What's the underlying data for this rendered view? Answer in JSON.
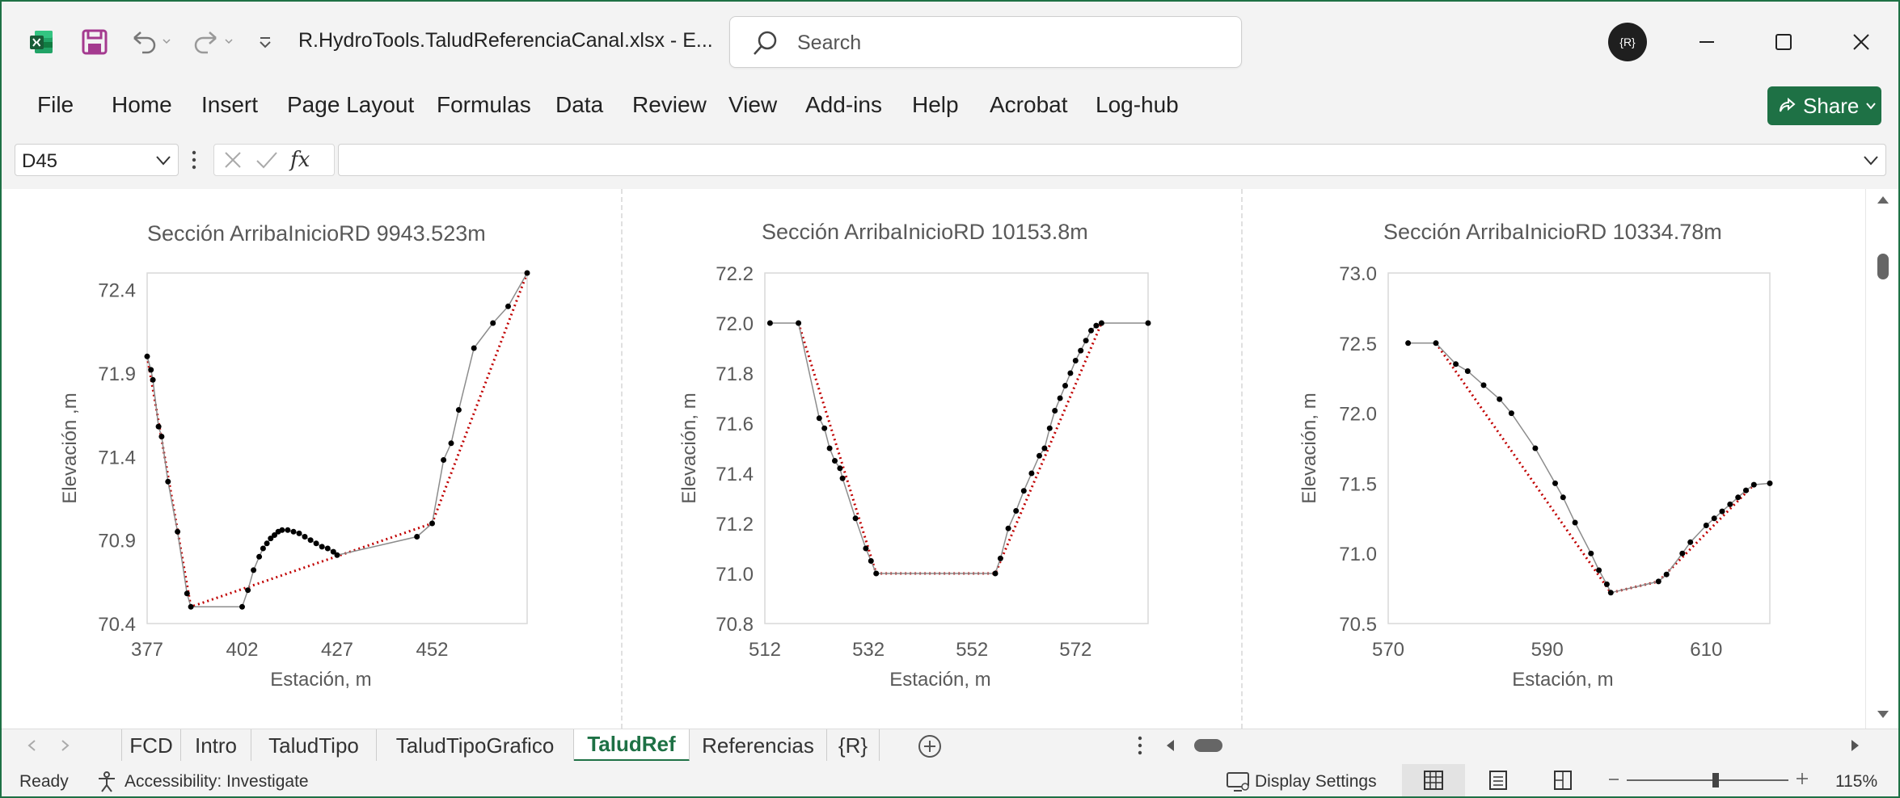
{
  "app": {
    "file_title": "R.HydroTools.TaludReferenciaCanal.xlsx  -  E...",
    "search_placeholder": "Search",
    "avatar_initials": "{R}",
    "share_label": "Share"
  },
  "ribbon": {
    "tabs": [
      "File",
      "Home",
      "Insert",
      "Page Layout",
      "Formulas",
      "Data",
      "Review",
      "View",
      "Add-ins",
      "Help",
      "Acrobat",
      "Log-hub"
    ]
  },
  "formula_bar": {
    "name_box": "D45",
    "fx_label": "fx",
    "formula": ""
  },
  "sheet_tabs": {
    "tabs": [
      "FCD",
      "Intro",
      "TaludTipo",
      "TaludTipoGrafico",
      "TaludRef",
      "Referencias",
      "{R}"
    ],
    "active": "TaludRef"
  },
  "status": {
    "ready": "Ready",
    "accessibility": "Accessibility: Investigate",
    "display_settings": "Display Settings",
    "zoom": "115%",
    "zoom_level_fraction": 0.55
  },
  "colors": {
    "brand_green": "#1e7145",
    "series_terrain": "#000000",
    "series_reference": "#c00000"
  },
  "chart_data": [
    {
      "type": "line",
      "title": "Sección ArribaInicioRD 9943.523m",
      "xlabel": "Estación, m",
      "ylabel": "Elevación ,m",
      "xlim": [
        377,
        477
      ],
      "ylim": [
        70.4,
        72.5
      ],
      "xticks": [
        "377",
        "402",
        "427",
        "452"
      ],
      "yticks": [
        "70.4",
        "70.9",
        "71.4",
        "71.9",
        "72.4"
      ],
      "xtick_values": [
        377,
        402,
        427,
        452
      ],
      "ytick_values": [
        70.4,
        70.9,
        71.4,
        71.9,
        72.4
      ],
      "terrain": [
        [
          377,
          72.0
        ],
        [
          378,
          71.92
        ],
        [
          378.5,
          71.86
        ],
        [
          380,
          71.58
        ],
        [
          380.8,
          71.52
        ],
        [
          382.5,
          71.25
        ],
        [
          385,
          70.95
        ],
        [
          387.5,
          70.58
        ],
        [
          388.5,
          70.5
        ],
        [
          402,
          70.5
        ],
        [
          403.5,
          70.6
        ],
        [
          405,
          70.72
        ],
        [
          406.5,
          70.8
        ],
        [
          407.5,
          70.85
        ],
        [
          408.5,
          70.88
        ],
        [
          409.5,
          70.91
        ],
        [
          410.5,
          70.93
        ],
        [
          411.5,
          70.95
        ],
        [
          412.5,
          70.96
        ],
        [
          414,
          70.96
        ],
        [
          415.5,
          70.95
        ],
        [
          417,
          70.94
        ],
        [
          418.5,
          70.92
        ],
        [
          420,
          70.9
        ],
        [
          421.5,
          70.88
        ],
        [
          423,
          70.86
        ],
        [
          424.5,
          70.85
        ],
        [
          426,
          70.83
        ],
        [
          427,
          70.81
        ],
        [
          448,
          70.92
        ],
        [
          452,
          71.0
        ],
        [
          455,
          71.38
        ],
        [
          457,
          71.48
        ],
        [
          459,
          71.68
        ],
        [
          463,
          72.05
        ],
        [
          468,
          72.2
        ],
        [
          472,
          72.3
        ],
        [
          477,
          72.5
        ]
      ],
      "reference": [
        [
          377,
          72.0
        ],
        [
          388.5,
          70.5
        ],
        [
          452,
          71.0
        ],
        [
          477,
          72.5
        ]
      ]
    },
    {
      "type": "line",
      "title": "Sección ArribaInicioRD 10153.8m",
      "xlabel": "Estación, m",
      "ylabel": "Elevación, m",
      "xlim": [
        512,
        586
      ],
      "ylim": [
        70.8,
        72.2
      ],
      "xticks": [
        "512",
        "532",
        "552",
        "572"
      ],
      "yticks": [
        "70.8",
        "71.0",
        "71.2",
        "71.4",
        "71.6",
        "71.8",
        "72.0",
        "72.2"
      ],
      "xtick_values": [
        512,
        532,
        552,
        572
      ],
      "ytick_values": [
        70.8,
        71.0,
        71.2,
        71.4,
        71.6,
        71.8,
        72.0,
        72.2
      ],
      "terrain": [
        [
          513,
          72.0
        ],
        [
          518.5,
          72.0
        ],
        [
          522.5,
          71.62
        ],
        [
          523.5,
          71.58
        ],
        [
          524.5,
          71.5
        ],
        [
          525.5,
          71.45
        ],
        [
          526.5,
          71.42
        ],
        [
          527,
          71.38
        ],
        [
          529.5,
          71.22
        ],
        [
          531.5,
          71.1
        ],
        [
          532.5,
          71.05
        ],
        [
          533.5,
          71.0
        ],
        [
          556.5,
          71.0
        ],
        [
          557.5,
          71.06
        ],
        [
          559,
          71.18
        ],
        [
          560.5,
          71.25
        ],
        [
          562,
          71.33
        ],
        [
          563.5,
          71.4
        ],
        [
          565,
          71.47
        ],
        [
          566,
          71.5
        ],
        [
          567,
          71.58
        ],
        [
          568,
          71.65
        ],
        [
          569,
          71.7
        ],
        [
          570,
          71.75
        ],
        [
          571,
          71.8
        ],
        [
          572,
          71.85
        ],
        [
          573,
          71.89
        ],
        [
          574,
          71.93
        ],
        [
          575,
          71.97
        ],
        [
          576,
          71.99
        ],
        [
          577,
          72.0
        ],
        [
          586,
          72.0
        ]
      ],
      "reference": [
        [
          518.5,
          72.0
        ],
        [
          533.5,
          71.0
        ],
        [
          556.5,
          71.0
        ],
        [
          577,
          72.0
        ]
      ]
    },
    {
      "type": "line",
      "title": "Sección ArribaInicioRD 10334.78m",
      "xlabel": "Estación, m",
      "ylabel": "Elevación, m",
      "xlim": [
        570,
        618
      ],
      "ylim": [
        70.5,
        73.0
      ],
      "xticks": [
        "570",
        "590",
        "610"
      ],
      "yticks": [
        "70.5",
        "71.0",
        "71.5",
        "72.0",
        "72.5",
        "73.0"
      ],
      "xtick_values": [
        570,
        590,
        610
      ],
      "ytick_values": [
        70.5,
        71.0,
        71.5,
        72.0,
        72.5,
        73.0
      ],
      "terrain": [
        [
          572.5,
          72.5
        ],
        [
          576,
          72.5
        ],
        [
          578.5,
          72.35
        ],
        [
          580,
          72.3
        ],
        [
          582,
          72.2
        ],
        [
          584,
          72.1
        ],
        [
          585.5,
          72.0
        ],
        [
          588.5,
          71.75
        ],
        [
          591,
          71.5
        ],
        [
          592,
          71.4
        ],
        [
          593.5,
          71.22
        ],
        [
          595.5,
          71.0
        ],
        [
          596.5,
          70.88
        ],
        [
          597.5,
          70.78
        ],
        [
          598,
          70.72
        ],
        [
          604,
          70.8
        ],
        [
          605,
          70.85
        ],
        [
          607,
          71.0
        ],
        [
          608,
          71.08
        ],
        [
          610,
          71.2
        ],
        [
          611,
          71.25
        ],
        [
          612,
          71.3
        ],
        [
          613,
          71.35
        ],
        [
          614,
          71.4
        ],
        [
          615,
          71.45
        ],
        [
          616,
          71.49
        ],
        [
          618,
          71.5
        ]
      ],
      "reference": [
        [
          576,
          72.5
        ],
        [
          598,
          70.72
        ],
        [
          604,
          70.8
        ],
        [
          616,
          71.49
        ]
      ]
    }
  ]
}
